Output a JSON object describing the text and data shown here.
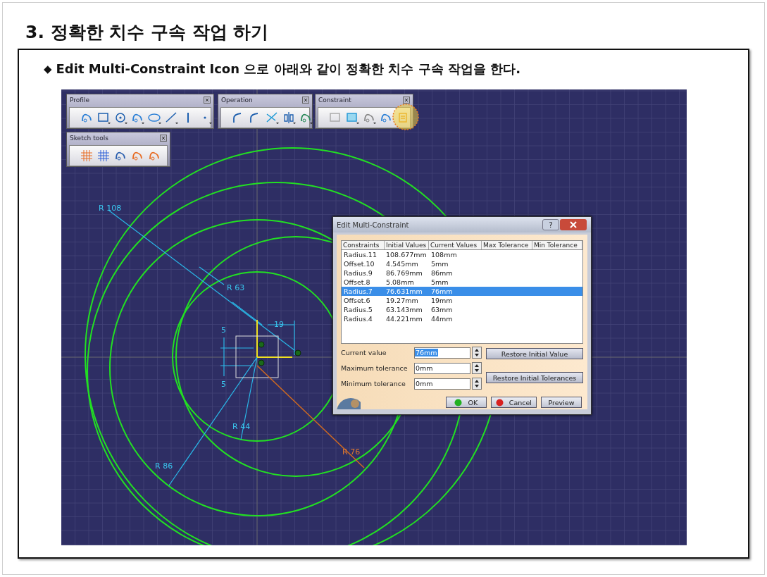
{
  "heading": "3. 정확한 치수 구속 작업 하기",
  "bullet": {
    "marker": "◆",
    "text": "Edit Multi-Constraint Icon 으로 아래와 같이 정확한 치수 구속 작업을 한다."
  },
  "toolbars": [
    {
      "title": "Profile"
    },
    {
      "title": "Operation"
    },
    {
      "title": "Constraint"
    },
    {
      "title": "Sketch tools"
    }
  ],
  "sketch_labels": [
    {
      "text": "R 108",
      "selected": false
    },
    {
      "text": "R 63",
      "selected": false
    },
    {
      "text": "19",
      "selected": false
    },
    {
      "text": "5",
      "selected": false
    },
    {
      "text": "5",
      "selected": false
    },
    {
      "text": "R 44",
      "selected": false
    },
    {
      "text": "R 86",
      "selected": false
    },
    {
      "text": "R 76",
      "selected": true
    }
  ],
  "dialog": {
    "title": "Edit Multi-Constraint",
    "help": "?",
    "columns": [
      "Constraints",
      "Initial Values",
      "Current Values",
      "Max Tolerance",
      "Min Tolerance"
    ],
    "rows": [
      {
        "cells": [
          "Radius.11",
          "108.677mm",
          "108mm"
        ],
        "selected": false
      },
      {
        "cells": [
          "Offset.10",
          "4.545mm",
          "5mm"
        ],
        "selected": false
      },
      {
        "cells": [
          "Radius.9",
          "86.769mm",
          "86mm"
        ],
        "selected": false
      },
      {
        "cells": [
          "Offset.8",
          "5.08mm",
          "5mm"
        ],
        "selected": false
      },
      {
        "cells": [
          "Radius.7",
          "76.631mm",
          "76mm"
        ],
        "selected": true
      },
      {
        "cells": [
          "Offset.6",
          "19.27mm",
          "19mm"
        ],
        "selected": false
      },
      {
        "cells": [
          "Radius.5",
          "63.143mm",
          "63mm"
        ],
        "selected": false
      },
      {
        "cells": [
          "Radius.4",
          "44.221mm",
          "44mm"
        ],
        "selected": false
      }
    ],
    "fields": [
      {
        "label": "Current value",
        "value": "76mm",
        "highlighted": true
      },
      {
        "label": "Maximum tolerance",
        "value": "0mm",
        "highlighted": false
      },
      {
        "label": "Minimum tolerance",
        "value": "0mm",
        "highlighted": false
      }
    ],
    "restore_buttons": [
      "Restore Initial Value",
      "Restore Initial Tolerances"
    ],
    "buttons": [
      {
        "label": "OK",
        "kind": "ok"
      },
      {
        "label": "Cancel",
        "kind": "cancel"
      },
      {
        "label": "Preview",
        "kind": "plain"
      }
    ]
  }
}
